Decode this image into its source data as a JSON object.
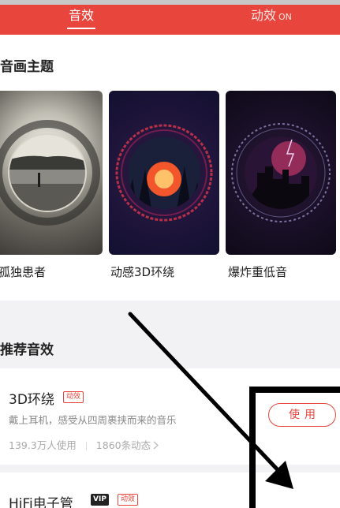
{
  "tabs": [
    {
      "label": "音效",
      "active": true
    },
    {
      "label": "动效",
      "state": "ON",
      "active": false
    }
  ],
  "theme_section": {
    "title": "音画主题",
    "cards": [
      {
        "label": "孤独患者",
        "thumbnail": "lonely-landscape-artwork"
      },
      {
        "label": "动感3D环绕",
        "thumbnail": "sunset-forest-ring-artwork"
      },
      {
        "label": "爆炸重低音",
        "thumbnail": "city-lightning-ring-artwork"
      }
    ]
  },
  "recommend_section": {
    "title": "推荐音效",
    "items": [
      {
        "title": "3D环绕",
        "badges": [
          "动效"
        ],
        "description": "戴上耳机，感受从四周裹挟而来的音乐",
        "users": "139.3万人使用",
        "posts": "1860条动态",
        "action": "使用"
      },
      {
        "title": "HiFi电子管",
        "badges": [
          "VIP",
          "动效"
        ]
      }
    ]
  },
  "colors": {
    "accent": "#e8453c",
    "background": "#f2f2f4"
  },
  "icons": {
    "chevron": "chevron-right-icon",
    "annotation": "annotation-arrow"
  }
}
